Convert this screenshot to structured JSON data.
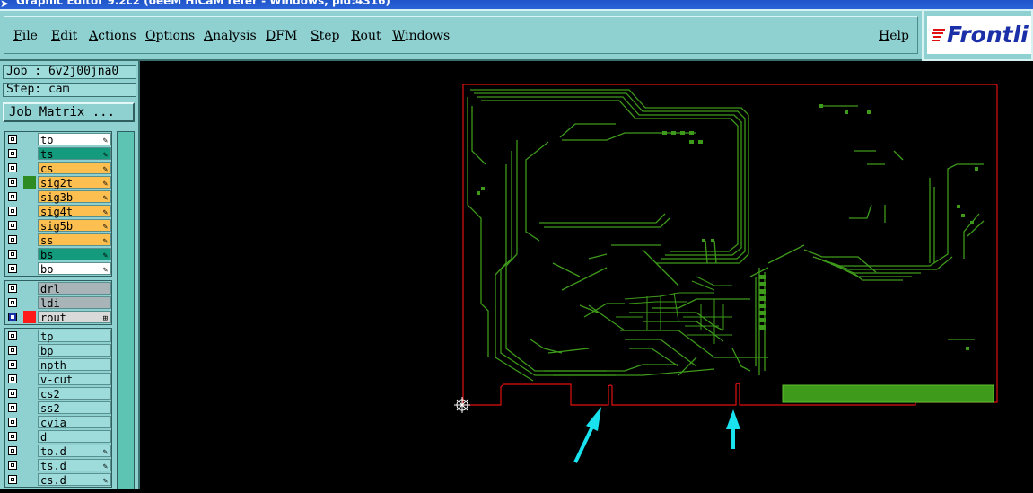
{
  "window": {
    "title": "Graphic Editor 9.2c2 (oeeM HiCaM refer - Windows, pid:4316)"
  },
  "menubar": {
    "items": [
      "File",
      "Edit",
      "Actions",
      "Options",
      "Analysis",
      "DFM",
      "Step",
      "Rout",
      "Windows"
    ],
    "help": "Help"
  },
  "logo": {
    "text": "Frontli"
  },
  "panel": {
    "job_label": "Job : 6v2j00jna0",
    "step_label": "Step: cam",
    "job_matrix_label": "Job Matrix ..."
  },
  "layers": {
    "group1": [
      {
        "name": "to",
        "color": "#ffffff",
        "mark": "✎"
      },
      {
        "name": "ts",
        "color": "#149a7c",
        "mark": "✎"
      },
      {
        "name": "cs",
        "color": "#fdbf50",
        "mark": "✎"
      },
      {
        "name": "sig2t",
        "color": "#fdbf50",
        "mark": "✎",
        "swatch": "#2e8b22"
      },
      {
        "name": "sig3b",
        "color": "#fdbf50",
        "mark": "✎"
      },
      {
        "name": "sig4t",
        "color": "#fdbf50",
        "mark": "✎"
      },
      {
        "name": "sig5b",
        "color": "#fdbf50",
        "mark": "✎"
      },
      {
        "name": "ss",
        "color": "#fdbf50",
        "mark": "✎"
      },
      {
        "name": "bs",
        "color": "#149a7c",
        "mark": "✎"
      },
      {
        "name": "bo",
        "color": "#ffffff",
        "mark": "✎"
      }
    ],
    "group2": [
      {
        "name": "drl",
        "color": "#a8b4b8",
        "mark": ""
      },
      {
        "name": "ldi",
        "color": "#a8b4b8",
        "mark": ""
      },
      {
        "name": "rout",
        "color": "#d9d9d9",
        "mark": "⊞",
        "swatch": "#ff1a1a",
        "active": true
      }
    ],
    "group3": [
      {
        "name": "tp",
        "color": "#9edcdc",
        "mark": ""
      },
      {
        "name": "bp",
        "color": "#9edcdc",
        "mark": ""
      },
      {
        "name": "npth",
        "color": "#9edcdc",
        "mark": ""
      },
      {
        "name": "v-cut",
        "color": "#9edcdc",
        "mark": ""
      },
      {
        "name": "cs2",
        "color": "#9edcdc",
        "mark": ""
      },
      {
        "name": "ss2",
        "color": "#9edcdc",
        "mark": ""
      },
      {
        "name": "cvia",
        "color": "#9edcdc",
        "mark": ""
      },
      {
        "name": "d",
        "color": "#9edcdc",
        "mark": ""
      },
      {
        "name": "to.d",
        "color": "#9edcdc",
        "mark": "✎"
      },
      {
        "name": "ts.d",
        "color": "#9edcdc",
        "mark": "✎"
      },
      {
        "name": "cs.d",
        "color": "#9edcdc",
        "mark": "✎"
      }
    ]
  },
  "colors": {
    "trace": "#3e9a1a",
    "outline": "#e01010",
    "arrow": "#19e3ef"
  }
}
